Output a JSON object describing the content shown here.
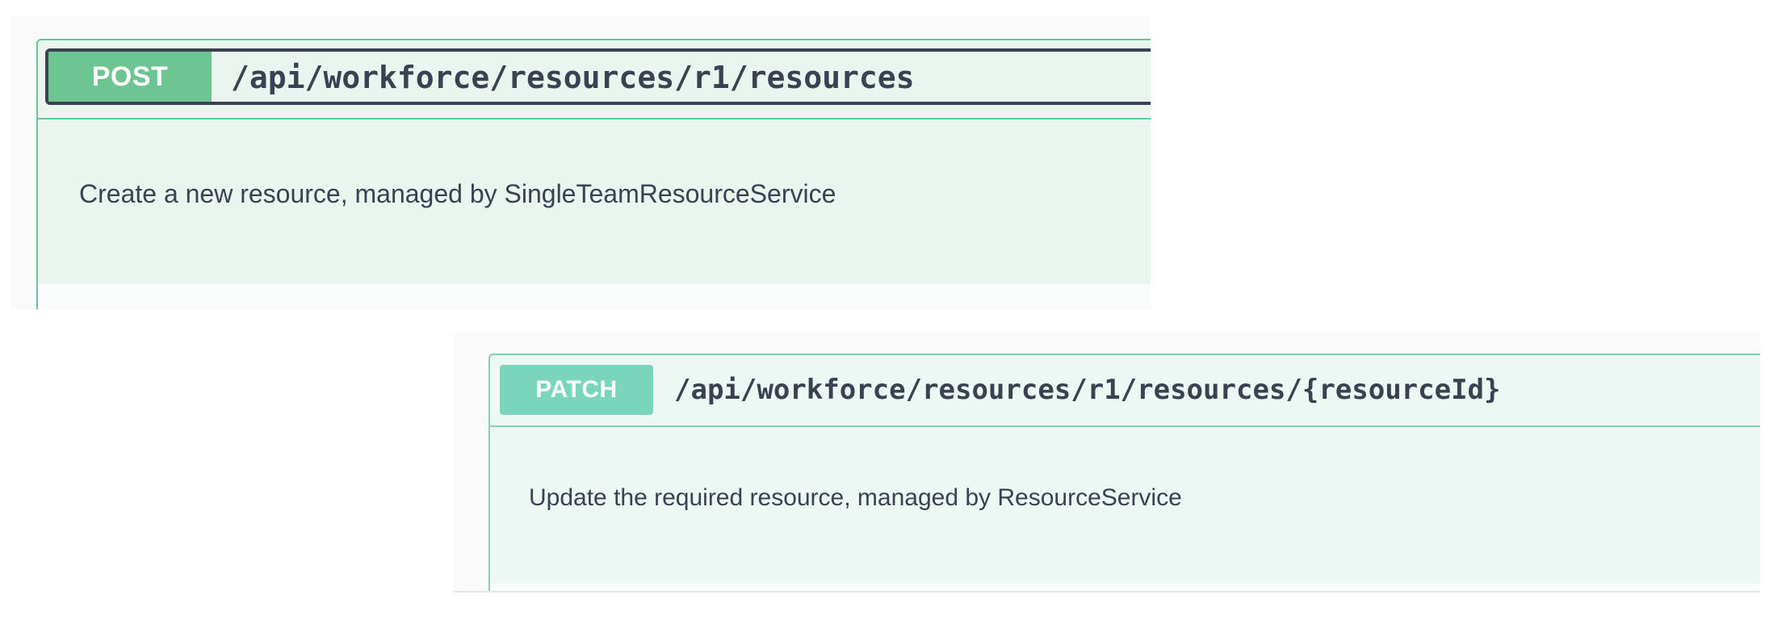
{
  "operations": [
    {
      "method": "POST",
      "path": "/api/workforce/resources/r1/resources",
      "description": "Create a new resource, managed by SingleTeamResourceService",
      "method_color": "#6dc592"
    },
    {
      "method": "PATCH",
      "path": "/api/workforce/resources/r1/resources/{resourceId}",
      "description": "Update the required resource, managed by ResourceService",
      "method_color": "#7ad6bb"
    }
  ]
}
